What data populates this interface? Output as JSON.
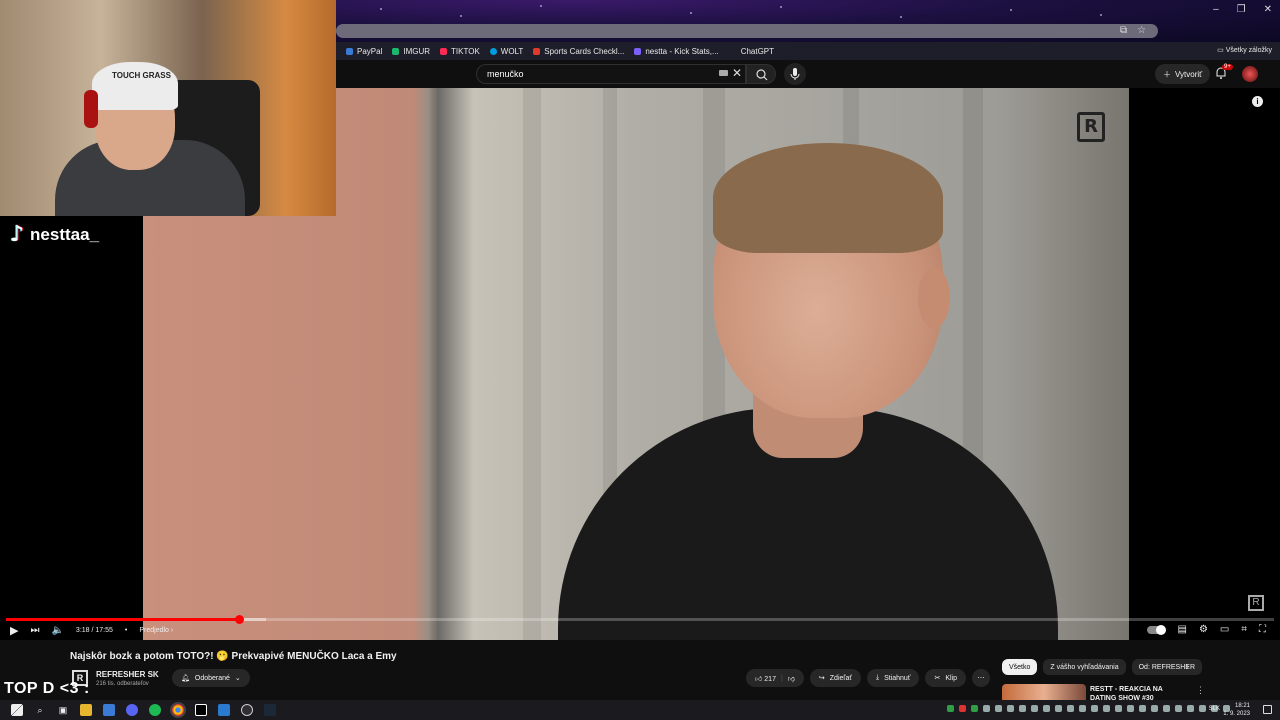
{
  "browser": {
    "bookmarks": [
      {
        "label": "PayPal",
        "color": "#3b7bd8"
      },
      {
        "label": "IMGUR",
        "color": "#1bb76e"
      },
      {
        "label": "TIKTOK",
        "color": "#fe2c55"
      },
      {
        "label": "WOLT",
        "color": "#009de0"
      },
      {
        "label": "Sports Cards Checkl...",
        "color": "#e23a2a"
      },
      {
        "label": "nestta - Kick Stats,...",
        "color": "#7d5fff"
      },
      {
        "label": "ChatGPT",
        "color": "#10a37f"
      }
    ],
    "all_bookmarks_label": "Všetky záložky"
  },
  "youtube": {
    "search_value": "menučko",
    "create_label": "Vytvoriť",
    "notification_count": "9+"
  },
  "overlay": {
    "tiktok_handle": "nesttaa_",
    "cap_text": "TOUCH GRASS",
    "bottom_text": "TOP D <3 :"
  },
  "player": {
    "time_display": "3:18 / 17:55",
    "chapter_label": "Predjedlo",
    "progress_fraction": 0.184,
    "buffered_fraction": 0.205
  },
  "video": {
    "title": "Najskôr bozk a potom TOTO?! 🫢 Prekvapivé MENUČKO Laca a Emy",
    "channel_name": "REFRESHER SK",
    "subscribers": "216 tis. odberateľov",
    "subscribed_label": "Odoberané",
    "likes": "217",
    "share_label": "Zdieľať",
    "download_label": "Stiahnuť",
    "clip_label": "Klip"
  },
  "recommendations": {
    "chips": [
      "Všetko",
      "Z vášho vyhľadávania",
      "Od: REFRESHER"
    ],
    "first_title": "RESTT - REAKCIA NA DATING SHOW #30"
  },
  "taskbar": {
    "language": "SLK",
    "time": "18:21",
    "date": "1. 9. 2023"
  }
}
